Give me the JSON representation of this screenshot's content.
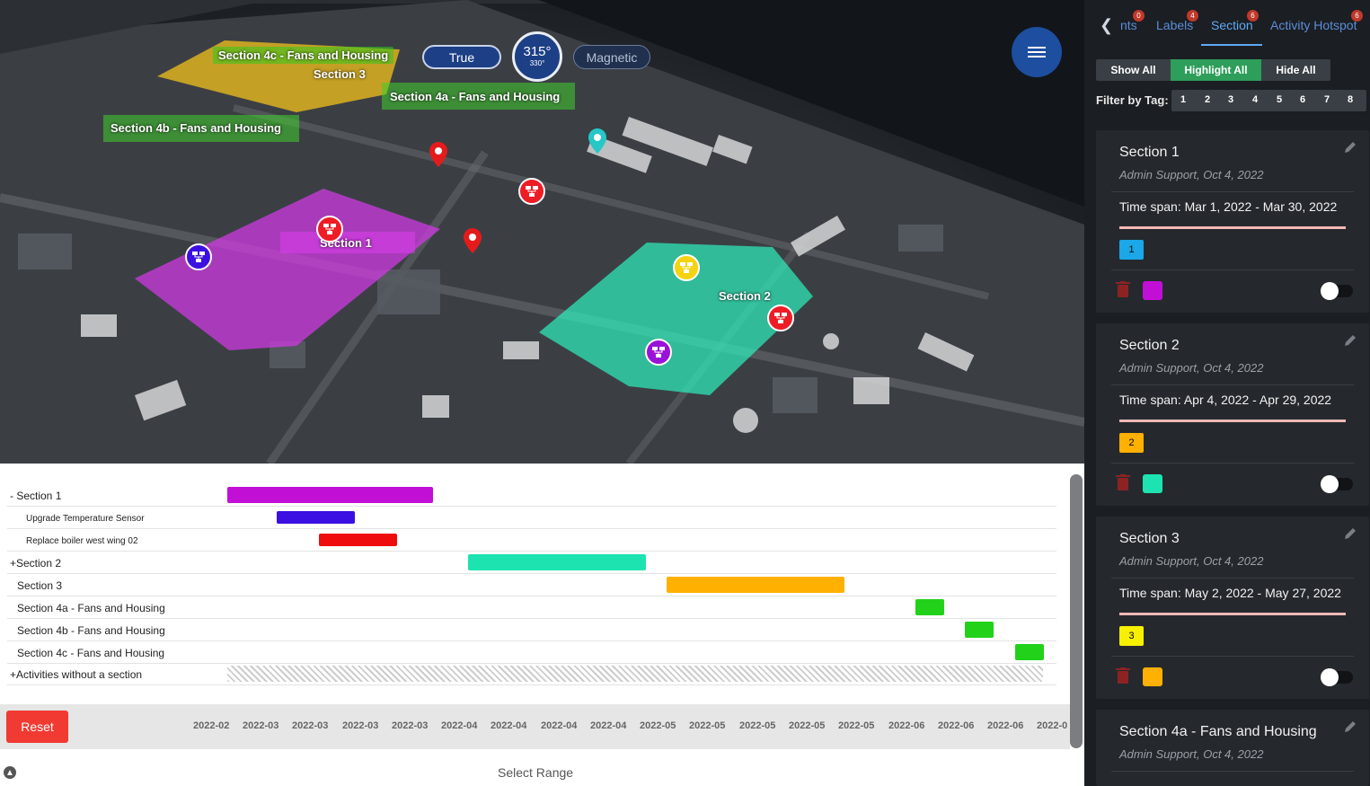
{
  "map": {
    "compass": {
      "true_label": "True",
      "magnetic_label": "Magnetic",
      "heading": "315°",
      "sub_heading": "330°"
    },
    "zones": [
      {
        "label": "Section 4c - Fans and Housing"
      },
      {
        "label": "Section 3"
      },
      {
        "label": "Section 4a - Fans and Housing"
      },
      {
        "label": "Section 4b - Fans and Housing"
      },
      {
        "label": "Section 1"
      },
      {
        "label": "Section 2"
      }
    ]
  },
  "gantt": {
    "rows": [
      {
        "label": "- Section 1"
      },
      {
        "label": "Upgrade Temperature Sensor"
      },
      {
        "label": "Replace boiler west wing 02"
      },
      {
        "label": "+Section 2"
      },
      {
        "label": "Section 3"
      },
      {
        "label": "Section 4a - Fans and Housing"
      },
      {
        "label": "Section 4b - Fans and Housing"
      },
      {
        "label": "Section 4c - Fans and Housing"
      },
      {
        "label": "+Activities without a section"
      }
    ],
    "colors": {
      "section1": "#c20fd6",
      "sensor": "#3b10e0",
      "boiler": "#ef0c0c",
      "section2": "#1de3b0",
      "section3": "#ffb000",
      "section4": "#22d11a"
    },
    "ticks": [
      "2022-02",
      "2022-03",
      "2022-03",
      "2022-03",
      "2022-03",
      "2022-04",
      "2022-04",
      "2022-04",
      "2022-04",
      "2022-05",
      "2022-05",
      "2022-05",
      "2022-05",
      "2022-05",
      "2022-06",
      "2022-06",
      "2022-06",
      "2022-0"
    ],
    "reset_label": "Reset",
    "select_range_label": "Select Range"
  },
  "panel": {
    "tabs": [
      {
        "label": "nts",
        "badge": "0"
      },
      {
        "label": "Labels",
        "badge": "4"
      },
      {
        "label": "Section",
        "badge": "6"
      },
      {
        "label": "Activity Hotspot",
        "badge": "6"
      }
    ],
    "visibility": {
      "show_all": "Show All",
      "highlight_all": "Highlight All",
      "hide_all": "Hide All"
    },
    "filter_label": "Filter by Tag:",
    "tags": [
      "1",
      "2",
      "3",
      "4",
      "5",
      "6",
      "7",
      "8"
    ],
    "cards": [
      {
        "title": "Section 1",
        "meta": "Admin Support, Oct 4, 2022",
        "span": "Time span: Mar 1, 2022 - Mar 30, 2022",
        "tag": "1",
        "tag_color": "#1ba7e8",
        "swatch": "#c20fd6"
      },
      {
        "title": "Section 2",
        "meta": "Admin Support, Oct 4, 2022",
        "span": "Time span: Apr 4, 2022 - Apr 29, 2022",
        "tag": "2",
        "tag_color": "#ffb000",
        "swatch": "#1de3b0"
      },
      {
        "title": "Section 3",
        "meta": "Admin Support, Oct 4, 2022",
        "span": "Time span: May 2, 2022 - May 27, 2022",
        "tag": "3",
        "tag_color": "#f7f000",
        "swatch": "#ffb000"
      },
      {
        "title": "Section 4a - Fans and Housing",
        "meta": "Admin Support, Oct 4, 2022"
      }
    ]
  }
}
